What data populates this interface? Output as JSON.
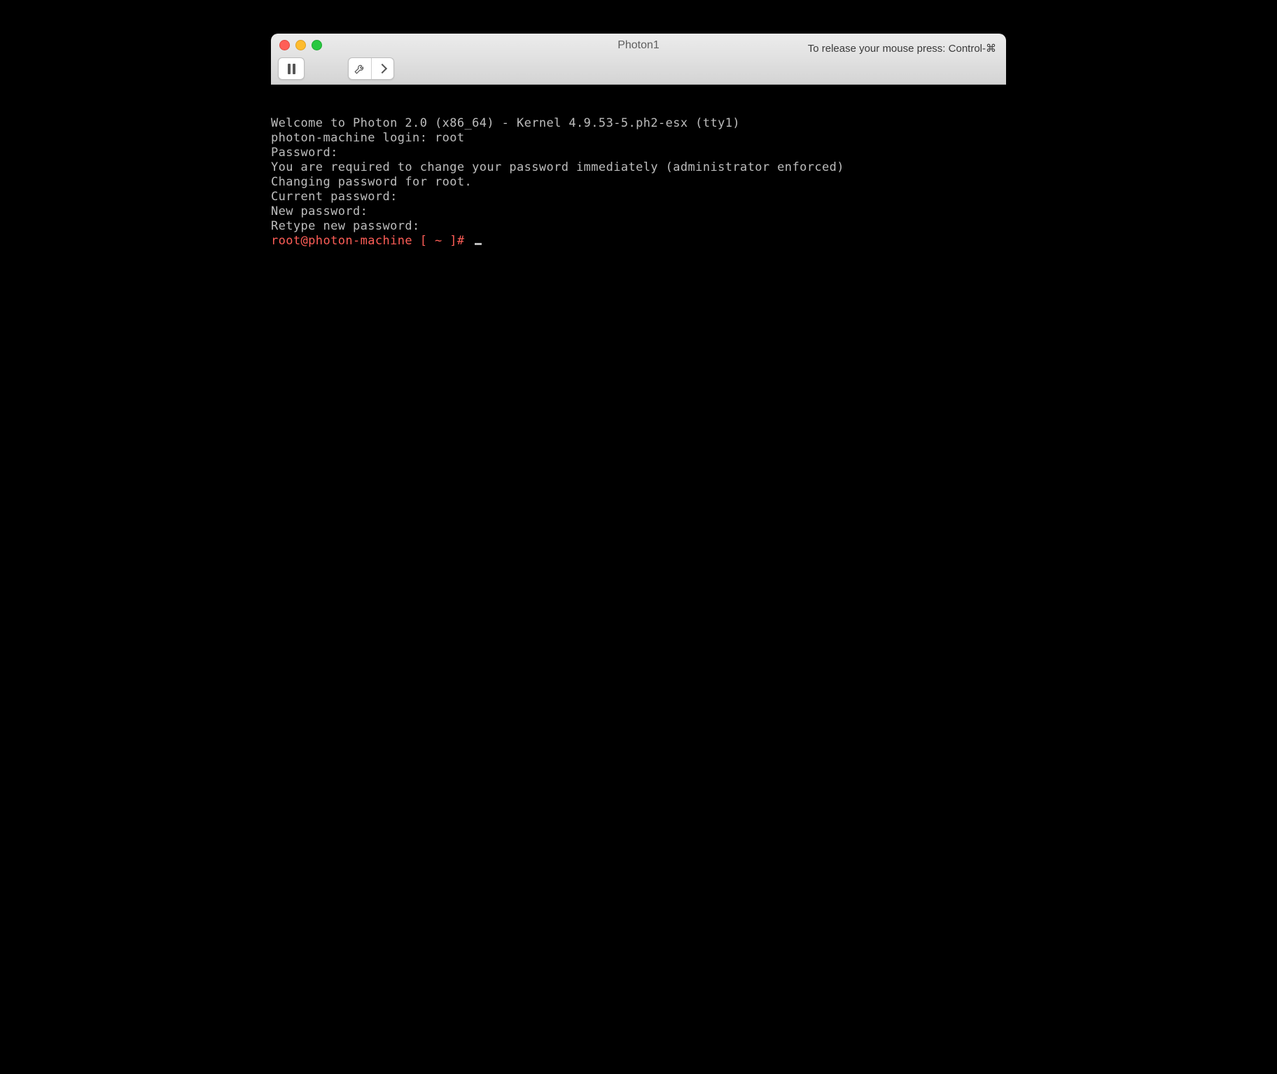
{
  "window": {
    "title": "Photon1",
    "release_hint": "To release your mouse press: Control-⌘"
  },
  "toolbar": {
    "pause_name": "pause",
    "settings_name": "settings",
    "next_name": "next"
  },
  "terminal": {
    "lines": [
      "Welcome to Photon 2.0 (x86_64) - Kernel 4.9.53-5.ph2-esx (tty1)",
      "photon-machine login: root",
      "Password:",
      "You are required to change your password immediately (administrator enforced)",
      "Changing password for root.",
      "Current password:",
      "New password:",
      "Retype new password:"
    ],
    "prompt": "root@photon-machine [ ~ ]# "
  },
  "colors": {
    "prompt": "#ff5e57",
    "text": "#bdbdbd",
    "bg": "#000000"
  }
}
